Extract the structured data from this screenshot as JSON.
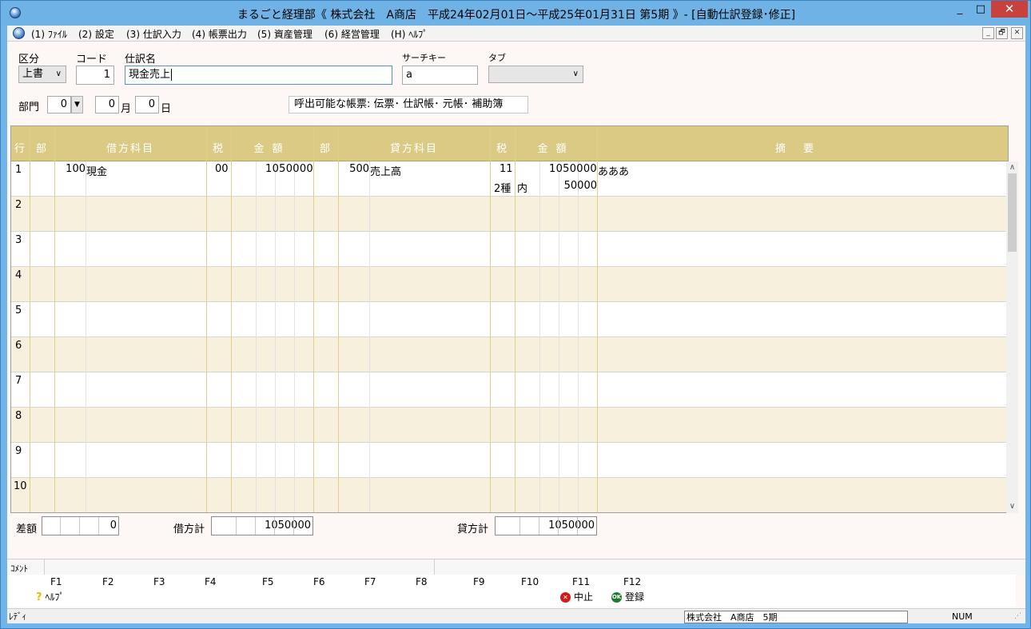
{
  "window": {
    "title": "まるごと経理部《 株式会社　A商店　平成24年02月01日～平成25年01月31日 第5期 》- [自動仕訳登録･修正]",
    "btn_min": "_",
    "btn_max": "□",
    "btn_close": "✕"
  },
  "menu": {
    "items": [
      "(1) ﾌｧｲﾙ",
      "(2) 設定",
      "(3) 仕訳入力",
      "(4) 帳票出力",
      "(5) 資産管理",
      "(6) 経営管理",
      "(H) ﾍﾙﾌﾟ"
    ],
    "mdi_min": "_",
    "mdi_restore": "🗗",
    "mdi_close": "✕"
  },
  "form": {
    "kubun_label": "区分",
    "kubun_value": "上書",
    "code_label": "コード",
    "code_value": "1",
    "name_label": "仕訳名",
    "name_value": "現金売上",
    "search_label": "サーチキー",
    "search_value": "a",
    "tab_label": "タブ",
    "tab_value": "",
    "dept_label": "部門",
    "dept_value": "0",
    "month_value": "0",
    "month_unit": "月",
    "day_value": "0",
    "day_unit": "日",
    "reports_text": "呼出可能な帳票: 伝票･ 仕訳帳･ 元帳･ 補助簿"
  },
  "grid": {
    "headers": {
      "row": "行",
      "dept": "部",
      "debit_account": "借方科目",
      "debit_tax": "税",
      "debit_amount": "金額",
      "credit_dept": "部",
      "credit_account": "貸方科目",
      "credit_tax": "税",
      "credit_amount": "金額",
      "memo": "摘要"
    },
    "row_numbers": [
      "1",
      "2",
      "3",
      "4",
      "5",
      "6",
      "7",
      "8",
      "9",
      "10"
    ],
    "row1": {
      "debit_code": "100",
      "debit_name": "現金",
      "debit_tax": "00",
      "debit_amount": "1050000",
      "credit_code": "500",
      "credit_name": "売上高",
      "credit_tax": "11",
      "credit_amount": "1050000",
      "memo": "あああ",
      "sub_tax": "2種",
      "sub_incl": "内",
      "sub_amount": "50000"
    }
  },
  "totals": {
    "diff_label": "差額",
    "diff_value": "0",
    "debit_label": "借方計",
    "debit_value": "1050000",
    "credit_label": "貸方計",
    "credit_value": "1050000"
  },
  "comment_label": "ｺﾒﾝﾄ",
  "fkeys": [
    "F1",
    "F2",
    "F3",
    "F4",
    "F5",
    "F6",
    "F7",
    "F8",
    "F9",
    "F10",
    "F11",
    "F12"
  ],
  "factions": {
    "help": "ﾍﾙﾌﾟ",
    "cancel": "中止",
    "register": "登録"
  },
  "status": {
    "ready": "ﾚﾃﾞｨ",
    "company": "株式会社　A商店　5期",
    "num": "NUM"
  }
}
